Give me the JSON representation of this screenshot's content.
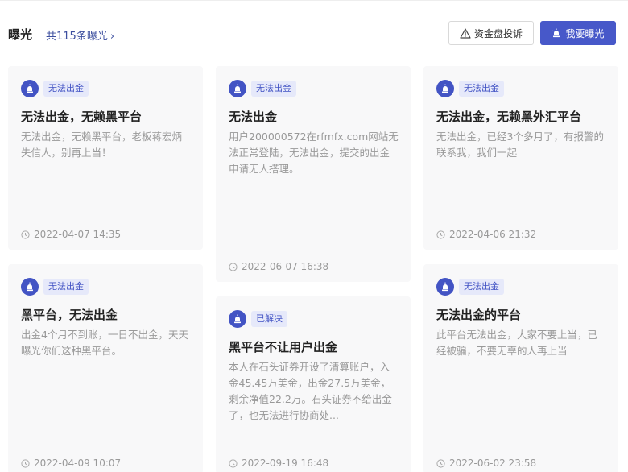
{
  "header": {
    "title": "曝光",
    "count_text": "共115条曝光",
    "chevron": "›",
    "complaint_label": "资金盘投诉",
    "expose_label": "我要曝光"
  },
  "colors": {
    "accent": "#4758c9",
    "tag_bg": "#e6e9fa",
    "card_bg": "#f8f8f9"
  },
  "cards": [
    {
      "tag": "无法出金",
      "title": "无法出金，无赖黑平台",
      "desc": "无法出金，无赖黑平台，老板蒋宏炳失信人，别再上当！",
      "time": "2022-04-07 14:35"
    },
    {
      "tag": "无法出金",
      "title": "无法出金",
      "desc": "用户200000572在rfmfx.com网站无法正常登陆，无法出金，提交的出金申请无人搭理。",
      "time": "2022-06-07 16:38"
    },
    {
      "tag": "无法出金",
      "title": "无法出金，无赖黑外汇平台",
      "desc": "无法出金，已经3个多月了，有报警的联系我，我们一起",
      "time": "2022-04-06 21:32"
    },
    {
      "tag": "无法出金",
      "title": "黑平台，无法出金",
      "desc": "出金4个月不到账，一日不出金，天天曝光你们这种黑平台。",
      "time": "2022-04-09 10:07"
    },
    {
      "tag": "已解决",
      "title": "黑平台不让用户出金",
      "desc": "本人在石头证券开设了清算账户，入金45.45万美金，出金27.5万美金，剩余净值22.2万。石头证券不给出金了，也无法进行协商处...",
      "time": "2022-09-19 16:48"
    },
    {
      "tag": "无法出金",
      "title": "无法出金的平台",
      "desc": "此平台无法出金，大家不要上当，已经被骗，不要无辜的人再上当",
      "time": "2022-06-02 23:58"
    }
  ]
}
